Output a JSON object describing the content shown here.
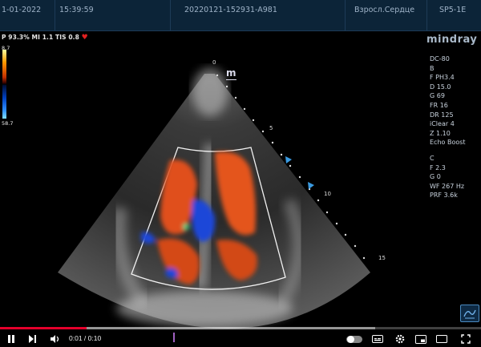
{
  "header": {
    "date": "1-01-2022",
    "time": "15:39:59",
    "exam_id": "20220121-152931-A981",
    "preset": "Взросл.Сердце",
    "probe": "SP5-1E"
  },
  "status_line": {
    "text": "P 93.3% MI 1.1 TIS 0.8",
    "heart_glyph": "♥"
  },
  "color_bar": {
    "top_value": "8.7",
    "bottom_value": "58.7"
  },
  "brand": "mindray",
  "marker_label": "m",
  "depth_marks": [
    "0",
    "5",
    "10",
    "15"
  ],
  "right_panel": {
    "mode_dc": "DC-80",
    "b_header": "B",
    "b_params": [
      "F PH3.4",
      "D 15.0",
      "G 69",
      "FR 16",
      "DR 125",
      "iClear 4",
      "Z 1.10",
      "Echo Boost"
    ],
    "c_header": "C",
    "c_params": [
      "F 2.3",
      "G 0",
      "WF 267 Hz",
      "PRF 3.6k"
    ]
  },
  "player": {
    "time_current": "0:01",
    "time_separator": " / ",
    "time_total": "0:10",
    "progress_played": 0.18,
    "progress_loaded": 0.78
  },
  "colors": {
    "header_bg": "#0c2438",
    "accent_progress": "#e4002b",
    "doppler_red": "#e0501a",
    "doppler_blue": "#1a46d8"
  }
}
